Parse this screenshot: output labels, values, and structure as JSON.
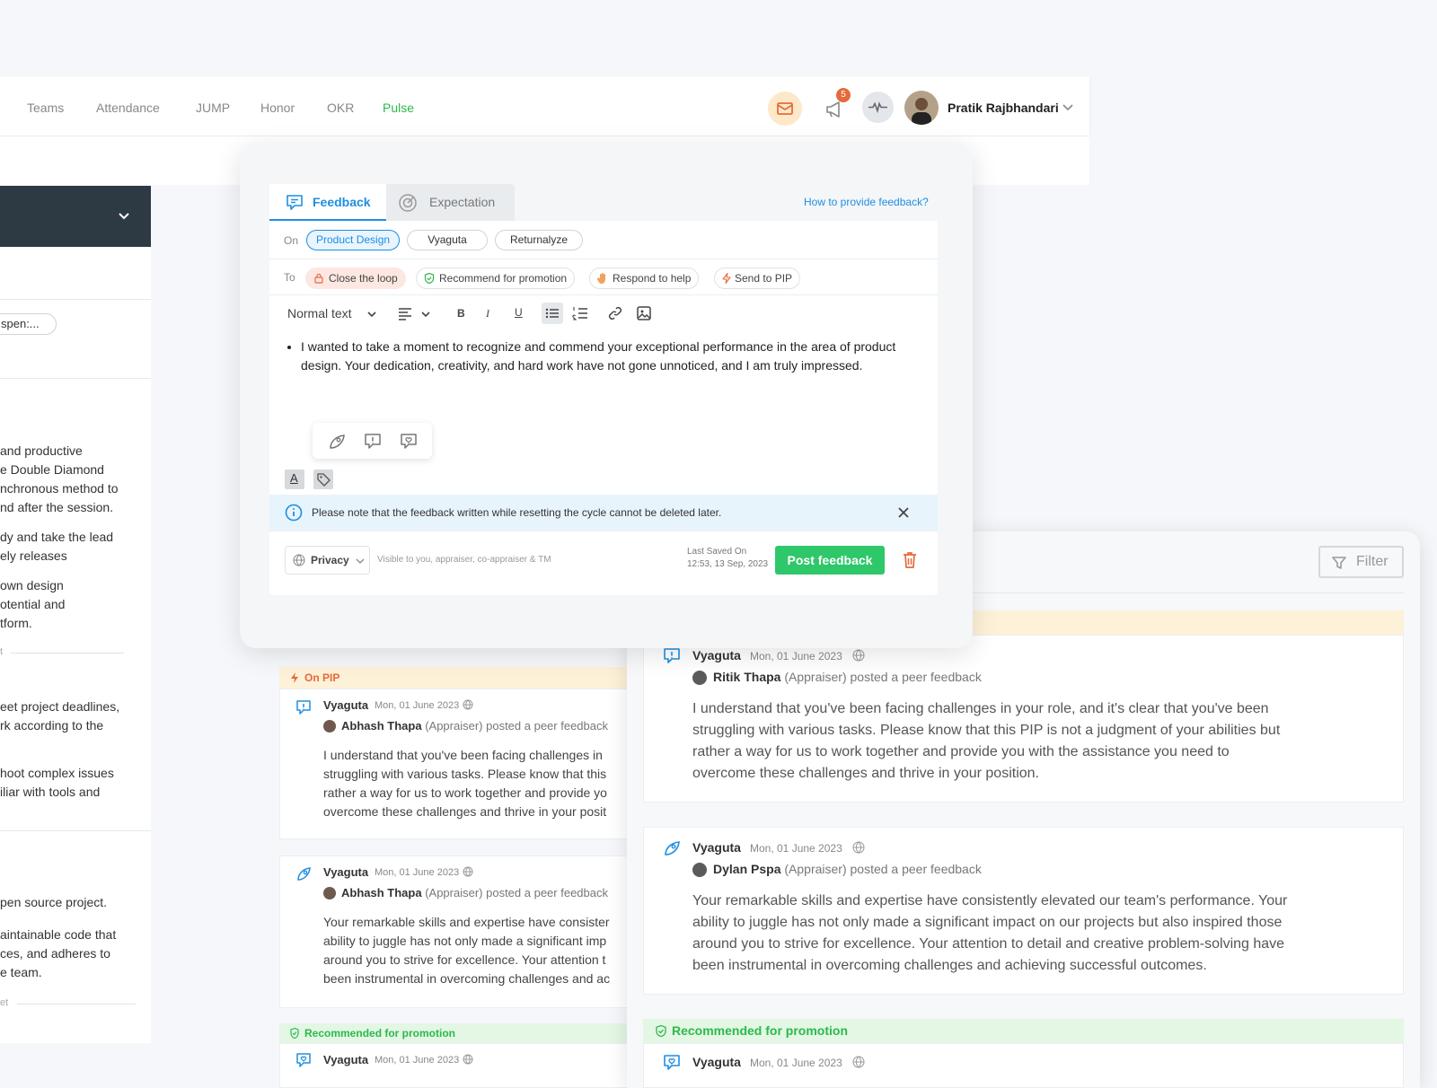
{
  "nav": {
    "items": [
      "Teams",
      "Attendance",
      "JUMP",
      "Honor",
      "OKR",
      "Pulse"
    ],
    "active": "Pulse",
    "notif_count": "5",
    "user_name": "Pratik Rajbhandari"
  },
  "left": {
    "chip": "spen:...",
    "lines": [
      " and productive",
      "e Double Diamond",
      "nchronous method to",
      "nd after the session.",
      "dy and take the lead",
      "ely releases",
      " own design",
      "otential and",
      "tform.",
      "eet project deadlines,",
      "rk according to the",
      "hoot complex issues",
      "iliar with tools and",
      "pen source project.",
      "aintainable code that",
      "ces, and adheres to",
      "e team."
    ],
    "divider_a": "t",
    "divider_b": "et"
  },
  "modal": {
    "tab_feedback": "Feedback",
    "tab_expectation": "Expectation",
    "help_link": "How to provide feedback?",
    "on_label": "On",
    "on_chips": [
      "Product Design",
      "Vyaguta",
      "Returnalyze"
    ],
    "to_label": "To",
    "to_pills": [
      "Close the loop",
      "Recommend for promotion",
      "Respond to help",
      "Send to PIP"
    ],
    "format_select": "Normal text",
    "body": "I wanted to take a moment to recognize and commend your exceptional performance in the area of product design. Your dedication, creativity, and hard work have not gone unnoticed, and I am truly impressed.",
    "notice": "Please note that the feedback written while resetting the cycle cannot be deleted later.",
    "privacy_label": "Privacy",
    "privacy_hint": "Visible to you, appraiser, co-appraiser & TM",
    "last_saved_label": "Last Saved On",
    "last_saved_time": "12:53, 13 Sep, 2023",
    "post_button": "Post feedback"
  },
  "middle": {
    "ribbon_pip": "On PIP",
    "ribbon_promo": "Recommended for promotion",
    "cards": [
      {
        "project": "Vyaguta",
        "date": "Mon, 01 June 2023",
        "author": "Abhash Thapa",
        "role_text": "(Appraiser) posted a peer feedback",
        "lines": [
          "I understand that you've been facing challenges in",
          "struggling with various tasks. Please know that this",
          "rather a way for us to work together and provide yo",
          "overcome these challenges and thrive in your posit"
        ]
      },
      {
        "project": "Vyaguta",
        "date": "Mon, 01 June 2023",
        "author": "Abhash Thapa",
        "role_text": "(Appraiser) posted a peer feedback",
        "lines": [
          "Your remarkable skills and expertise have consister",
          "ability to juggle has not only made a significant imp",
          "around you to strive for excellence. Your attention t",
          "been instrumental in overcoming challenges and ac"
        ]
      },
      {
        "project": "Vyaguta",
        "date": "Mon, 01 June 2023"
      }
    ]
  },
  "right": {
    "filter": "Filter",
    "ribbon_promo": "Recommended for promotion",
    "cards": [
      {
        "project": "Vyaguta",
        "date": "Mon, 01 June 2023",
        "author": "Ritik Thapa",
        "role_text": "(Appraiser) posted a peer feedback",
        "lines": [
          "I understand that you've been facing challenges in your role, and it's clear that you've been",
          "struggling with various tasks. Please know that this PIP is not a judgment of your abilities but",
          "rather a way for us to work together and provide you with the assistance you need to",
          "overcome these challenges and thrive in your position."
        ]
      },
      {
        "project": "Vyaguta",
        "date": "Mon, 01 June 2023",
        "author": "Dylan Pspa",
        "role_text": "(Appraiser) posted a peer feedback",
        "lines": [
          "Your remarkable skills and expertise have consistently elevated our team's performance. Your",
          "ability to juggle has not only made a significant impact on our projects but also inspired those",
          "around you to strive for excellence. Your attention to detail and creative problem-solving have",
          "been instrumental in overcoming challenges and achieving successful outcomes."
        ]
      },
      {
        "project": "Vyaguta",
        "date": "Mon, 01 June 2023"
      }
    ]
  },
  "colors": {
    "accent_blue": "#1d8fe1",
    "success_green": "#2ec76a",
    "warning_orange": "#e56a3a",
    "pip_bg": "#fdf1d8",
    "promo_bg": "#e3f7e4"
  }
}
